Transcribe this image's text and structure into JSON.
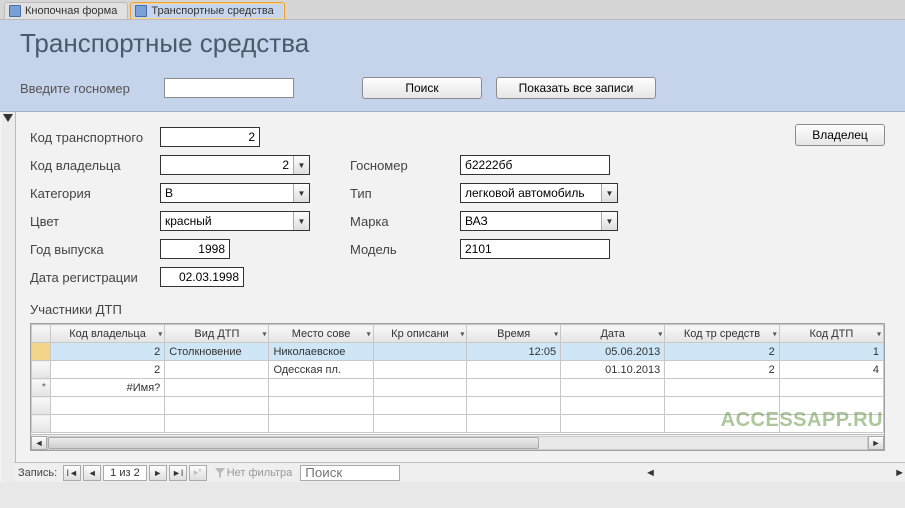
{
  "tabs": [
    {
      "label": "Кнопочная форма",
      "active": false
    },
    {
      "label": "Транспортные средства",
      "active": true
    }
  ],
  "header": {
    "title": "Транспортные средства",
    "search_label": "Введите госномер",
    "search_value": "",
    "btn_search": "Поиск",
    "btn_showall": "Показать все записи"
  },
  "form": {
    "left": {
      "code_transport": {
        "label": "Код транспортного",
        "value": "2"
      },
      "code_owner": {
        "label": "Код владельца",
        "value": "2"
      },
      "category": {
        "label": "Категория",
        "value": "B"
      },
      "color": {
        "label": "Цвет",
        "value": "красный"
      },
      "year": {
        "label": "Год выпуска",
        "value": "1998"
      },
      "reg_date": {
        "label": "Дата регистрации",
        "value": "02.03.1998"
      }
    },
    "right": {
      "gosnum": {
        "label": "Госномер",
        "value": "б2222бб"
      },
      "type": {
        "label": "Тип",
        "value": "легковой автомобиль"
      },
      "brand": {
        "label": "Марка",
        "value": "ВАЗ"
      },
      "model": {
        "label": "Модель",
        "value": "2101"
      }
    },
    "btn_owner": "Владелец"
  },
  "subform": {
    "title": "Участники ДТП",
    "columns": [
      "Код владельца",
      "Вид ДТП",
      "Место сове",
      "Кр описани",
      "Время",
      "Дата",
      "Код тр средств",
      "Код ДТП"
    ],
    "rows": [
      {
        "selected": true,
        "marker": "",
        "cells": [
          "2",
          "Столкновение",
          "Николаевское",
          "",
          "12:05",
          "05.06.2013",
          "2",
          "1"
        ]
      },
      {
        "selected": false,
        "marker": "",
        "cells": [
          "2",
          "",
          "Одесская пл.",
          "",
          "",
          "01.10.2013",
          "2",
          "4"
        ]
      },
      {
        "selected": false,
        "marker": "*",
        "cells": [
          "#Имя?",
          "",
          "",
          "",
          "",
          "",
          "",
          ""
        ]
      }
    ]
  },
  "recnav": {
    "label": "Запись:",
    "position": "1 из 2",
    "filter": "Нет фильтра",
    "search_placeholder": "Поиск"
  },
  "watermark": "ACCESSAPP.RU"
}
